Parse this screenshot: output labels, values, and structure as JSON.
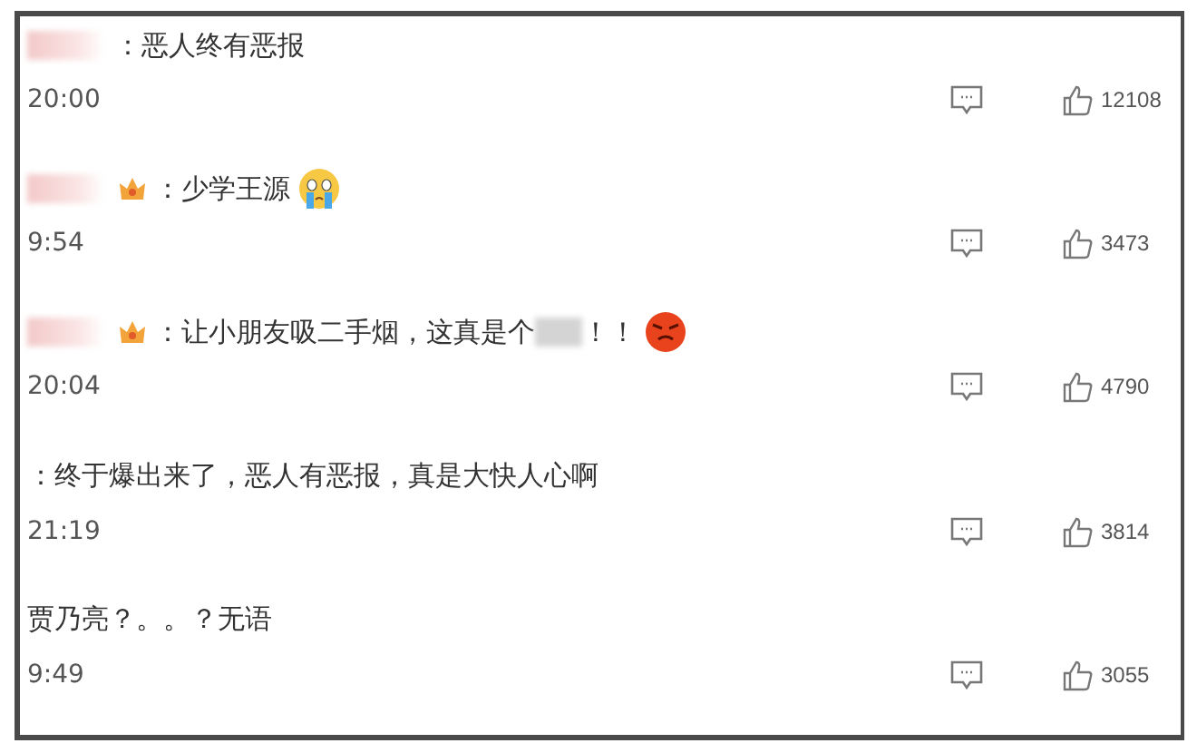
{
  "comments": [
    {
      "name_hidden": true,
      "badge": false,
      "parts": [
        {
          "kind": "text",
          "text": "：恶人终有恶报"
        }
      ],
      "time": "20:00",
      "likes": "12108"
    },
    {
      "name_hidden": true,
      "badge": true,
      "parts": [
        {
          "kind": "text",
          "text": "：少学王源"
        },
        {
          "kind": "crying"
        }
      ],
      "time": "9:54",
      "likes": "3473"
    },
    {
      "name_hidden": true,
      "badge": true,
      "parts": [
        {
          "kind": "text",
          "text": "：让小朋友吸二手烟，这真是个"
        },
        {
          "kind": "redacted"
        },
        {
          "kind": "text",
          "text": "！！"
        },
        {
          "kind": "angry"
        }
      ],
      "time": "20:04",
      "likes": "4790"
    },
    {
      "name_hidden": false,
      "badge": false,
      "parts": [
        {
          "kind": "text",
          "text": "：终于爆出来了，恶人有恶报，真是大快人心啊"
        }
      ],
      "time": "21:19",
      "likes": "3814"
    },
    {
      "name_hidden": false,
      "badge": false,
      "parts": [
        {
          "kind": "text",
          "text": "贾乃亮？。。？无语"
        }
      ],
      "time": "9:49",
      "likes": "3055"
    }
  ]
}
